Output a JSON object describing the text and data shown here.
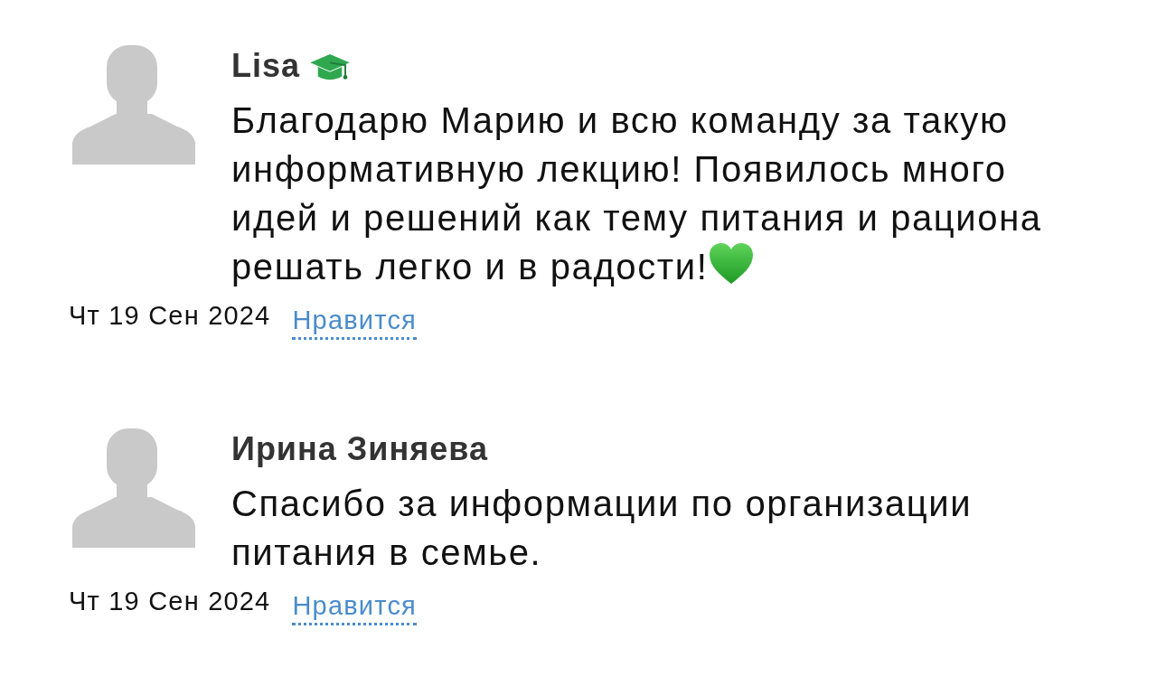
{
  "comments": [
    {
      "author": "Lisa",
      "badge": true,
      "text": "Благодарю Марию и всю команду за такую информативную лекцию! Появилось много идей и решений как тему питания и рациона решать легко и в радости!",
      "heart": true,
      "date": "Чт 19 Сен 2024",
      "like": "Нравится"
    },
    {
      "author": "Ирина Зиняева",
      "badge": false,
      "text": "Спасибо за информации по организации питания в семье.",
      "heart": false,
      "date": "Чт 19 Сен 2024",
      "like": "Нравится"
    }
  ]
}
